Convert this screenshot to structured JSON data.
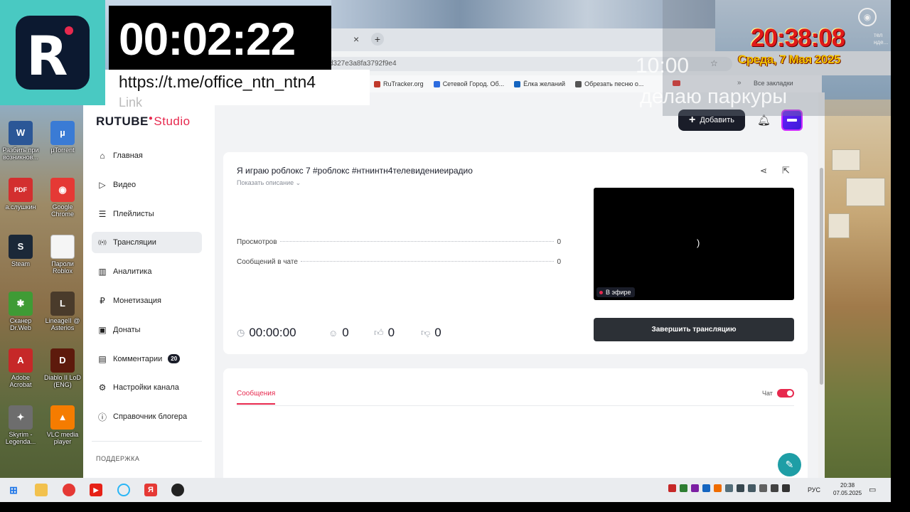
{
  "desktop": {
    "icons": [
      {
        "label": "Разбить при возникнов...",
        "icon": "word-doc-icon",
        "color": "#2b5797",
        "glyph": "W"
      },
      {
        "label": "µTorrent",
        "icon": "torrent-icon",
        "color": "#3a7bd5",
        "glyph": "µ"
      },
      {
        "label": "а.слушкин",
        "icon": "pdf-icon",
        "color": "#d32f2f",
        "glyph": "PDF"
      },
      {
        "label": "Google Chrome",
        "icon": "chrome-icon",
        "color": "#e53935",
        "glyph": "◉"
      },
      {
        "label": "Steam",
        "icon": "steam-icon",
        "color": "#1b2838",
        "glyph": "S"
      },
      {
        "label": "Пароли Roblox",
        "icon": "text-file-icon",
        "color": "#f5f5f5",
        "glyph": ""
      },
      {
        "label": "Сканер Dr.Web",
        "icon": "drweb-icon",
        "color": "#3f9b35",
        "glyph": "✱"
      },
      {
        "label": "LineageII @ Asterios",
        "icon": "lineage-icon",
        "color": "#4a3b2b",
        "glyph": "L"
      },
      {
        "label": "Adobe Acrobat",
        "icon": "acrobat-icon",
        "color": "#c62828",
        "glyph": "A"
      },
      {
        "label": "Diablo II LoD (ENG)",
        "icon": "diablo-icon",
        "color": "#5d1a0c",
        "glyph": "D"
      },
      {
        "label": "Skyrim - Legenda...",
        "icon": "skyrim-icon",
        "color": "#6d6d6d",
        "glyph": "✦"
      },
      {
        "label": "VLC media player",
        "icon": "vlc-icon",
        "color": "#f57c00",
        "glyph": "▲"
      }
    ]
  },
  "overlay": {
    "timer": "00:02:22",
    "link": "https://t.me/office_ntn_ntn4",
    "link_label": "Link",
    "clock": "20:38:08",
    "date": "Среда, 7 Мая 2025",
    "countdown": "10:00",
    "scroll_text": "делаю паркуры",
    "side_snippet": "тел\nнде..."
  },
  "browser": {
    "tab_close": "×",
    "tab_new": "+",
    "url": "d327e3a8fa3792f9e4",
    "bookmarks": [
      {
        "label": "RuTracker.org",
        "color": "#c0392b"
      },
      {
        "label": "Сетевой Город. Об...",
        "color": "#2d6cdf"
      },
      {
        "label": "Ёлка желаний",
        "color": "#1565c0"
      },
      {
        "label": "Обрезать песню о...",
        "color": "#555555"
      }
    ],
    "more": "»",
    "all_bookmarks": "Все закладки"
  },
  "studio": {
    "logo_main": "RUTUBE",
    "logo_studio": "Studio",
    "add_button": "Добавить",
    "nav": [
      {
        "label": "Главная",
        "icon": "home-icon",
        "glyph": "⌂"
      },
      {
        "label": "Видео",
        "icon": "video-icon",
        "glyph": "▷"
      },
      {
        "label": "Плейлисты",
        "icon": "playlist-icon",
        "glyph": "☰"
      },
      {
        "label": "Трансляции",
        "icon": "broadcast-icon",
        "glyph": "((•))",
        "active": true
      },
      {
        "label": "Аналитика",
        "icon": "analytics-icon",
        "glyph": "▥"
      },
      {
        "label": "Монетизация",
        "icon": "monetization-icon",
        "glyph": "₽"
      },
      {
        "label": "Донаты",
        "icon": "donations-icon",
        "glyph": "▣"
      },
      {
        "label": "Комментарии",
        "icon": "comments-icon",
        "glyph": "▤",
        "badge": "20"
      },
      {
        "label": "Настройки канала",
        "icon": "settings-icon",
        "glyph": "⚙"
      },
      {
        "label": "Справочник блогера",
        "icon": "info-icon",
        "glyph": "ⓘ"
      }
    ],
    "support": "ПОДДЕРЖКА",
    "stream": {
      "title": "Я играю роблокс 7 #роблокс #нтнинтн4телевидениеирадио",
      "show_description": "Показать описание ⌄",
      "views_label": "Просмотров",
      "views": "0",
      "chat_messages_label": "Сообщений в чате",
      "chat_messages": "0",
      "duration": "00:00:00",
      "viewers": "0",
      "likes": "0",
      "dislikes": "0",
      "live_badge": "В эфире",
      "player_glyph": ")",
      "end_button": "Завершить трансляцию"
    },
    "chat": {
      "tab_messages": "Сообщения",
      "chat_label": "Чат",
      "chat_enabled": true
    }
  },
  "taskbar": {
    "lang": "РУС",
    "time": "20:38",
    "date": "07.05.2025"
  }
}
